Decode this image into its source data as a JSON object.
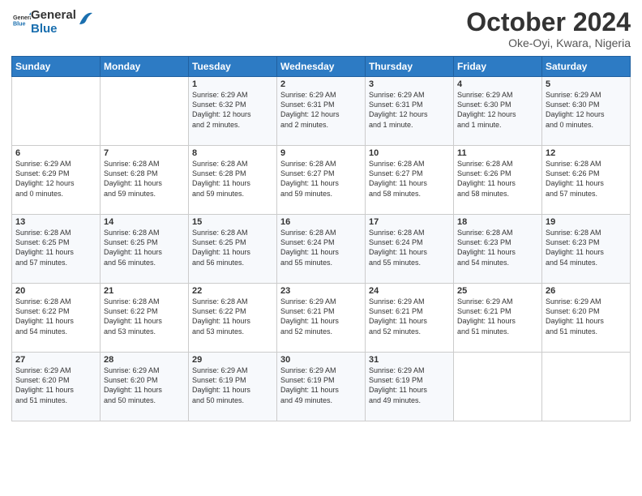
{
  "header": {
    "logo_general": "General",
    "logo_blue": "Blue",
    "month": "October 2024",
    "location": "Oke-Oyi, Kwara, Nigeria"
  },
  "days_of_week": [
    "Sunday",
    "Monday",
    "Tuesday",
    "Wednesday",
    "Thursday",
    "Friday",
    "Saturday"
  ],
  "weeks": [
    [
      {
        "day": "",
        "content": ""
      },
      {
        "day": "",
        "content": ""
      },
      {
        "day": "1",
        "content": "Sunrise: 6:29 AM\nSunset: 6:32 PM\nDaylight: 12 hours\nand 2 minutes."
      },
      {
        "day": "2",
        "content": "Sunrise: 6:29 AM\nSunset: 6:31 PM\nDaylight: 12 hours\nand 2 minutes."
      },
      {
        "day": "3",
        "content": "Sunrise: 6:29 AM\nSunset: 6:31 PM\nDaylight: 12 hours\nand 1 minute."
      },
      {
        "day": "4",
        "content": "Sunrise: 6:29 AM\nSunset: 6:30 PM\nDaylight: 12 hours\nand 1 minute."
      },
      {
        "day": "5",
        "content": "Sunrise: 6:29 AM\nSunset: 6:30 PM\nDaylight: 12 hours\nand 0 minutes."
      }
    ],
    [
      {
        "day": "6",
        "content": "Sunrise: 6:29 AM\nSunset: 6:29 PM\nDaylight: 12 hours\nand 0 minutes."
      },
      {
        "day": "7",
        "content": "Sunrise: 6:28 AM\nSunset: 6:28 PM\nDaylight: 11 hours\nand 59 minutes."
      },
      {
        "day": "8",
        "content": "Sunrise: 6:28 AM\nSunset: 6:28 PM\nDaylight: 11 hours\nand 59 minutes."
      },
      {
        "day": "9",
        "content": "Sunrise: 6:28 AM\nSunset: 6:27 PM\nDaylight: 11 hours\nand 59 minutes."
      },
      {
        "day": "10",
        "content": "Sunrise: 6:28 AM\nSunset: 6:27 PM\nDaylight: 11 hours\nand 58 minutes."
      },
      {
        "day": "11",
        "content": "Sunrise: 6:28 AM\nSunset: 6:26 PM\nDaylight: 11 hours\nand 58 minutes."
      },
      {
        "day": "12",
        "content": "Sunrise: 6:28 AM\nSunset: 6:26 PM\nDaylight: 11 hours\nand 57 minutes."
      }
    ],
    [
      {
        "day": "13",
        "content": "Sunrise: 6:28 AM\nSunset: 6:25 PM\nDaylight: 11 hours\nand 57 minutes."
      },
      {
        "day": "14",
        "content": "Sunrise: 6:28 AM\nSunset: 6:25 PM\nDaylight: 11 hours\nand 56 minutes."
      },
      {
        "day": "15",
        "content": "Sunrise: 6:28 AM\nSunset: 6:25 PM\nDaylight: 11 hours\nand 56 minutes."
      },
      {
        "day": "16",
        "content": "Sunrise: 6:28 AM\nSunset: 6:24 PM\nDaylight: 11 hours\nand 55 minutes."
      },
      {
        "day": "17",
        "content": "Sunrise: 6:28 AM\nSunset: 6:24 PM\nDaylight: 11 hours\nand 55 minutes."
      },
      {
        "day": "18",
        "content": "Sunrise: 6:28 AM\nSunset: 6:23 PM\nDaylight: 11 hours\nand 54 minutes."
      },
      {
        "day": "19",
        "content": "Sunrise: 6:28 AM\nSunset: 6:23 PM\nDaylight: 11 hours\nand 54 minutes."
      }
    ],
    [
      {
        "day": "20",
        "content": "Sunrise: 6:28 AM\nSunset: 6:22 PM\nDaylight: 11 hours\nand 54 minutes."
      },
      {
        "day": "21",
        "content": "Sunrise: 6:28 AM\nSunset: 6:22 PM\nDaylight: 11 hours\nand 53 minutes."
      },
      {
        "day": "22",
        "content": "Sunrise: 6:28 AM\nSunset: 6:22 PM\nDaylight: 11 hours\nand 53 minutes."
      },
      {
        "day": "23",
        "content": "Sunrise: 6:29 AM\nSunset: 6:21 PM\nDaylight: 11 hours\nand 52 minutes."
      },
      {
        "day": "24",
        "content": "Sunrise: 6:29 AM\nSunset: 6:21 PM\nDaylight: 11 hours\nand 52 minutes."
      },
      {
        "day": "25",
        "content": "Sunrise: 6:29 AM\nSunset: 6:21 PM\nDaylight: 11 hours\nand 51 minutes."
      },
      {
        "day": "26",
        "content": "Sunrise: 6:29 AM\nSunset: 6:20 PM\nDaylight: 11 hours\nand 51 minutes."
      }
    ],
    [
      {
        "day": "27",
        "content": "Sunrise: 6:29 AM\nSunset: 6:20 PM\nDaylight: 11 hours\nand 51 minutes."
      },
      {
        "day": "28",
        "content": "Sunrise: 6:29 AM\nSunset: 6:20 PM\nDaylight: 11 hours\nand 50 minutes."
      },
      {
        "day": "29",
        "content": "Sunrise: 6:29 AM\nSunset: 6:19 PM\nDaylight: 11 hours\nand 50 minutes."
      },
      {
        "day": "30",
        "content": "Sunrise: 6:29 AM\nSunset: 6:19 PM\nDaylight: 11 hours\nand 49 minutes."
      },
      {
        "day": "31",
        "content": "Sunrise: 6:29 AM\nSunset: 6:19 PM\nDaylight: 11 hours\nand 49 minutes."
      },
      {
        "day": "",
        "content": ""
      },
      {
        "day": "",
        "content": ""
      }
    ]
  ]
}
